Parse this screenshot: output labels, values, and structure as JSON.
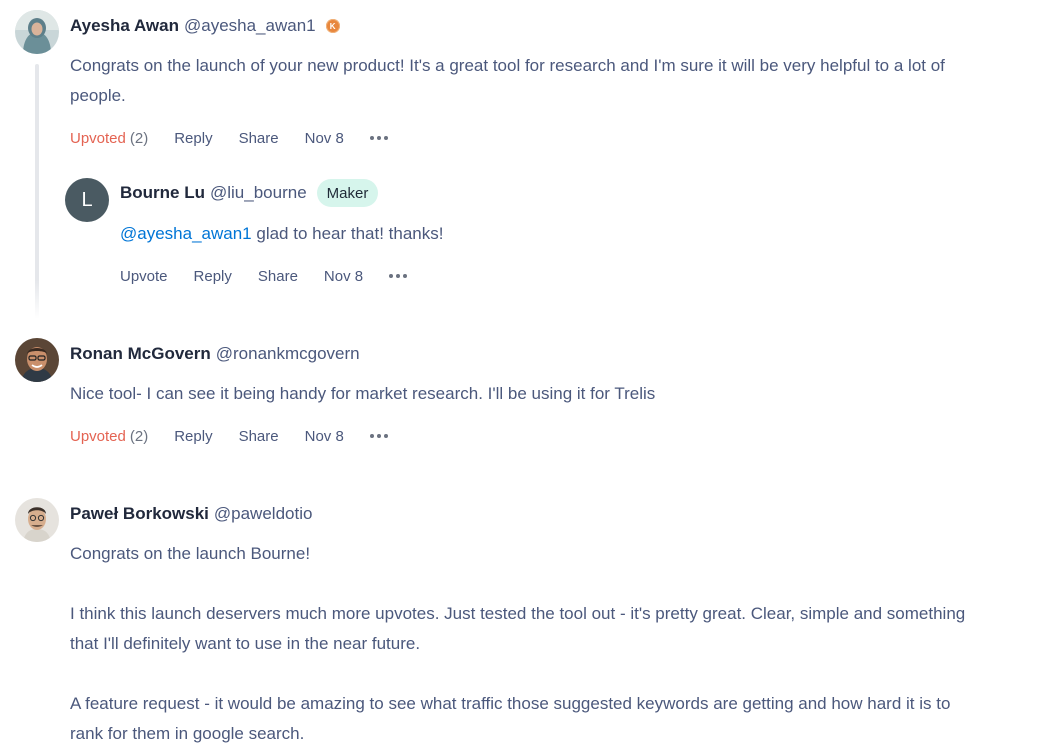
{
  "comments": [
    {
      "name": "Ayesha Awan",
      "handle": "@ayesha_awan1",
      "karma_badge": "K",
      "body_lines": [
        "Congrats on the launch of your new product! It's a great tool for research and I'm sure it will be very helpful to a lot of",
        "people."
      ],
      "actions": {
        "vote_label": "Upvoted",
        "vote_count": "(2)",
        "reply": "Reply",
        "share": "Share",
        "date": "Nov 8"
      },
      "reply": {
        "avatar_letter": "L",
        "name": "Bourne Lu",
        "handle": "@liu_bourne",
        "badge": "Maker",
        "mention": "@ayesha_awan1",
        "body": " glad to hear that! thanks!",
        "actions": {
          "vote_label": "Upvote",
          "reply": "Reply",
          "share": "Share",
          "date": "Nov 8"
        }
      }
    },
    {
      "name": "Ronan McGovern",
      "handle": "@ronankmcgovern",
      "body_lines": [
        "Nice tool- I can see it being handy for market research. I'll be using it for Trelis"
      ],
      "actions": {
        "vote_label": "Upvoted",
        "vote_count": "(2)",
        "reply": "Reply",
        "share": "Share",
        "date": "Nov 8"
      }
    },
    {
      "name": "Paweł Borkowski",
      "handle": "@paweldotio",
      "body_lines": [
        "Congrats on the launch Bourne!",
        "",
        "I think this launch deservers much more upvotes. Just tested the tool out - it's pretty great. Clear, simple and something",
        "that I'll definitely want to use in the near future.",
        "",
        "A feature request - it would be amazing to see what traffic those suggested keywords are getting and how hard it is to",
        "rank for them in google search."
      ]
    }
  ],
  "colors": {
    "upvoted": "#e46352",
    "mention": "#0075d6",
    "maker_badge_bg": "#d6f5ec",
    "karma_badge": "#e8873d"
  }
}
